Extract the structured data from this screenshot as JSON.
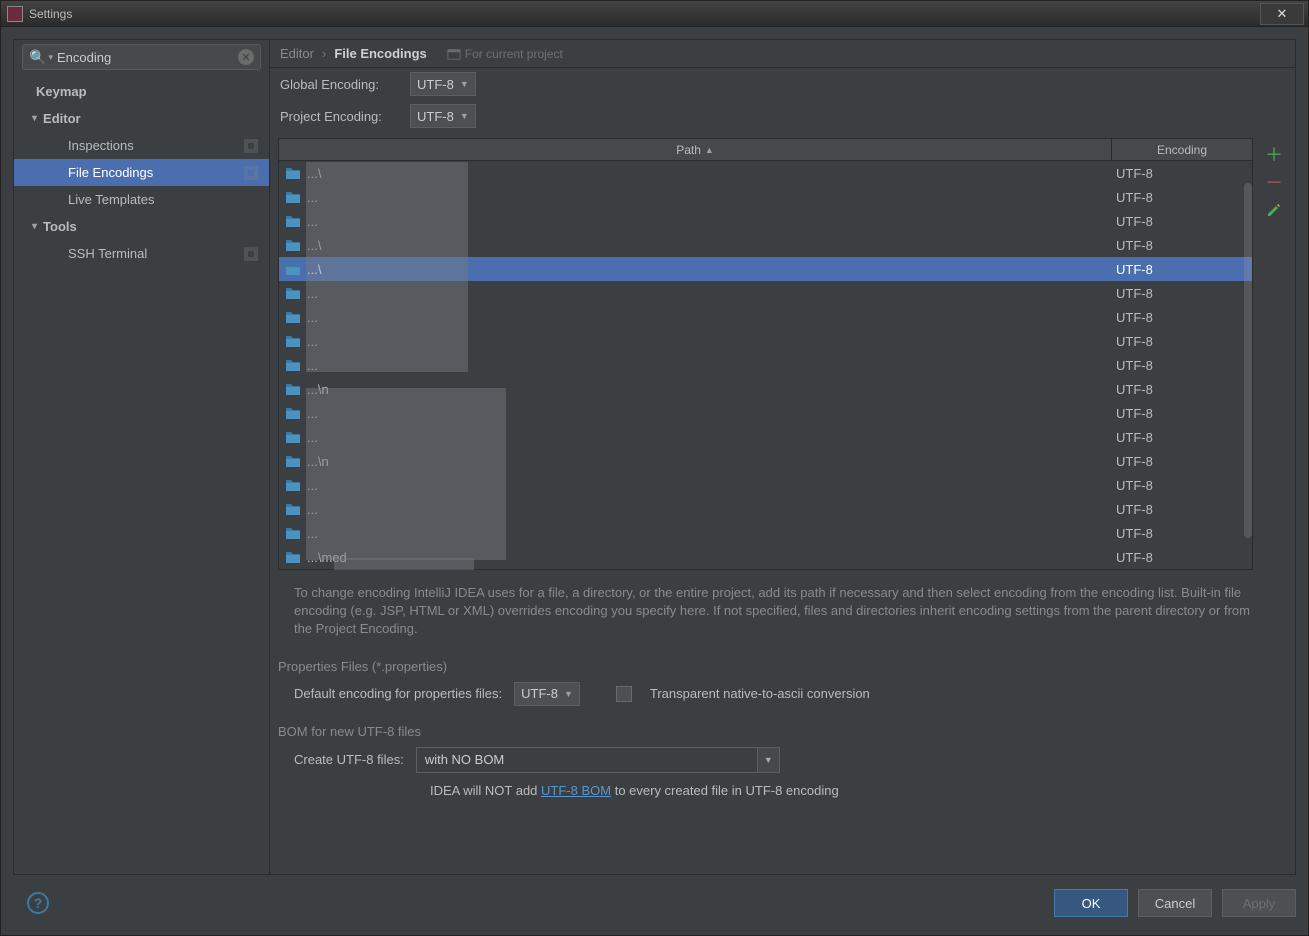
{
  "window": {
    "title": "Settings"
  },
  "search": {
    "value": "Encoding"
  },
  "sidebar": {
    "items": [
      {
        "label": "Keymap",
        "kind": "bold"
      },
      {
        "label": "Editor",
        "kind": "cat"
      },
      {
        "label": "Inspections",
        "kind": "sub",
        "badge": true
      },
      {
        "label": "File Encodings",
        "kind": "sub",
        "badge": true,
        "selected": true
      },
      {
        "label": "Live Templates",
        "kind": "sub"
      },
      {
        "label": "Tools",
        "kind": "cat"
      },
      {
        "label": "SSH Terminal",
        "kind": "sub",
        "badge": true
      }
    ]
  },
  "breadcrumb": {
    "a": "Editor",
    "b": "File Encodings",
    "scope": "For current project"
  },
  "globalEncoding": {
    "label": "Global Encoding:",
    "value": "UTF-8"
  },
  "projectEncoding": {
    "label": "Project Encoding:",
    "value": "UTF-8"
  },
  "table": {
    "headers": {
      "path": "Path",
      "encoding": "Encoding"
    },
    "rows": [
      {
        "path": "...\\",
        "encoding": "UTF-8"
      },
      {
        "path": "...",
        "encoding": "UTF-8"
      },
      {
        "path": "...",
        "encoding": "UTF-8"
      },
      {
        "path": "...\\",
        "encoding": "UTF-8"
      },
      {
        "path": "...\\",
        "encoding": "UTF-8",
        "selected": true
      },
      {
        "path": "...",
        "encoding": "UTF-8"
      },
      {
        "path": "...",
        "encoding": "UTF-8"
      },
      {
        "path": "...",
        "encoding": "UTF-8"
      },
      {
        "path": "...",
        "encoding": "UTF-8"
      },
      {
        "path": "...\\n",
        "encoding": "UTF-8"
      },
      {
        "path": "...",
        "encoding": "UTF-8"
      },
      {
        "path": "...",
        "encoding": "UTF-8"
      },
      {
        "path": "...\\n",
        "encoding": "UTF-8"
      },
      {
        "path": "...",
        "encoding": "UTF-8"
      },
      {
        "path": "...",
        "encoding": "UTF-8"
      },
      {
        "path": "...",
        "encoding": "UTF-8"
      },
      {
        "path": "...\\med",
        "encoding": "UTF-8"
      }
    ]
  },
  "description": "To change encoding IntelliJ IDEA uses for a file, a directory, or the entire project, add its path if necessary and then select encoding from the encoding list. Built-in file encoding (e.g. JSP, HTML or XML) overrides encoding you specify here. If not specified, files and directories inherit encoding settings from the parent directory or from the Project Encoding.",
  "properties": {
    "section": "Properties Files (*.properties)",
    "defaultLabel": "Default encoding for properties files:",
    "defaultValue": "UTF-8",
    "transparentLabel": "Transparent native-to-ascii conversion"
  },
  "bom": {
    "section": "BOM for new UTF-8 files",
    "createLabel": "Create UTF-8 files:",
    "createValue": "with NO BOM",
    "hintPrefix": "IDEA will NOT add ",
    "hintLink": "UTF-8 BOM",
    "hintSuffix": " to every created file in UTF-8 encoding"
  },
  "buttons": {
    "ok": "OK",
    "cancel": "Cancel",
    "apply": "Apply"
  }
}
